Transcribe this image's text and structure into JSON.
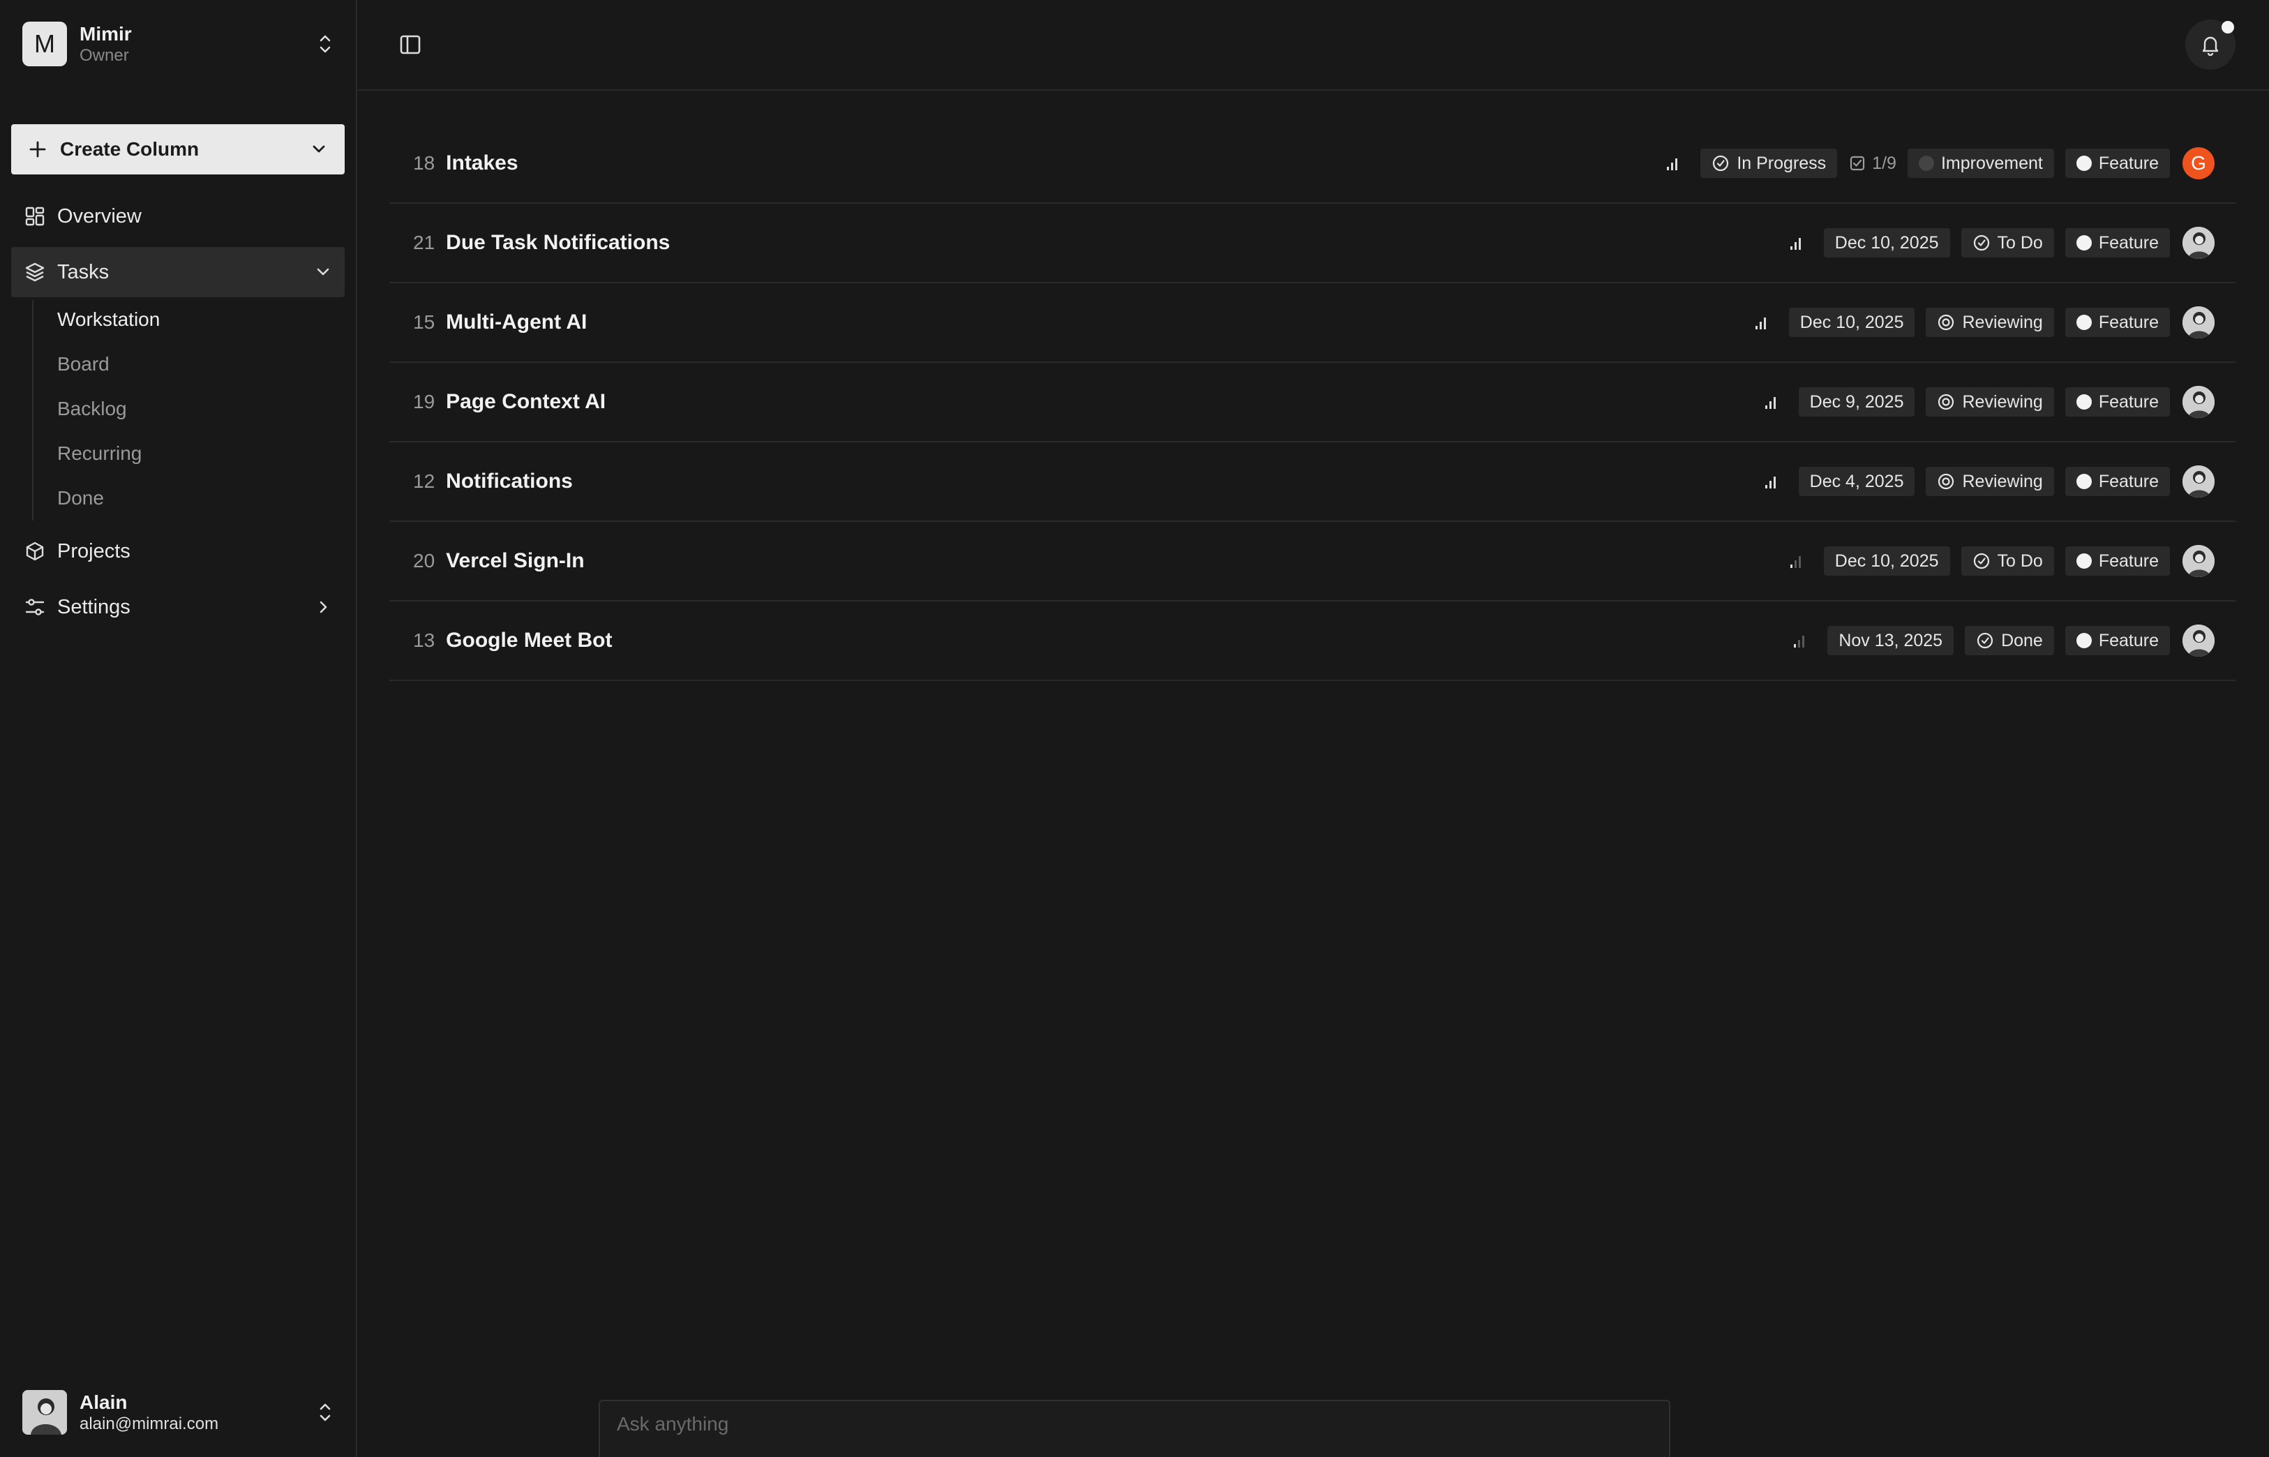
{
  "workspace": {
    "initial": "M",
    "name": "Mimir",
    "role": "Owner"
  },
  "sidebar": {
    "create_label": "Create Column",
    "items": [
      {
        "label": "Overview",
        "icon": "grid-icon"
      },
      {
        "label": "Tasks",
        "icon": "layers-icon"
      },
      {
        "label": "Projects",
        "icon": "box-icon"
      },
      {
        "label": "Settings",
        "icon": "sliders-icon"
      }
    ],
    "tasks_sub": [
      {
        "label": "Workstation"
      },
      {
        "label": "Board"
      },
      {
        "label": "Backlog"
      },
      {
        "label": "Recurring"
      },
      {
        "label": "Done"
      }
    ]
  },
  "user": {
    "name": "Alain",
    "email": "alain@mimrai.com"
  },
  "tasks": [
    {
      "num": "18",
      "title": "Intakes",
      "status": "In Progress",
      "subtasks": "1/9",
      "label2": "Improvement",
      "label": "Feature",
      "assignee": "G"
    },
    {
      "num": "21",
      "title": "Due Task Notifications",
      "date": "Dec 10, 2025",
      "status": "To Do",
      "label": "Feature"
    },
    {
      "num": "15",
      "title": "Multi-Agent AI",
      "date": "Dec 10, 2025",
      "status": "Reviewing",
      "label": "Feature"
    },
    {
      "num": "19",
      "title": "Page Context AI",
      "date": "Dec 9, 2025",
      "status": "Reviewing",
      "label": "Feature"
    },
    {
      "num": "12",
      "title": "Notifications",
      "date": "Dec 4, 2025",
      "status": "Reviewing",
      "label": "Feature"
    },
    {
      "num": "20",
      "title": "Vercel Sign-In",
      "date": "Dec 10, 2025",
      "status": "To Do",
      "label": "Feature"
    },
    {
      "num": "13",
      "title": "Google Meet Bot",
      "date": "Nov 13, 2025",
      "status": "Done",
      "label": "Feature"
    }
  ],
  "ask": {
    "placeholder": "Ask anything"
  },
  "colors": {
    "accent_orange": "#f0541e",
    "background": "#181818",
    "chip": "#2a2a2a"
  }
}
